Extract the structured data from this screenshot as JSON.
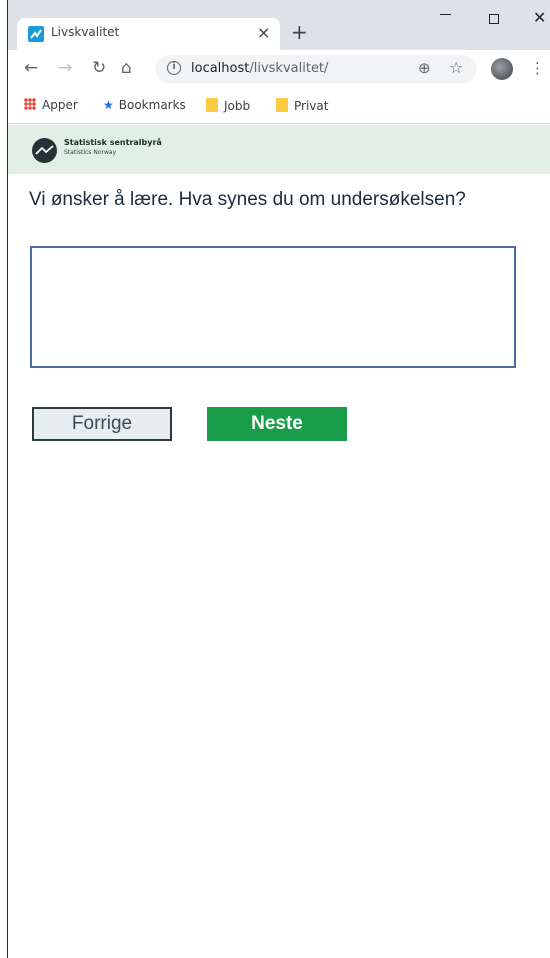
{
  "browser": {
    "tab_title": "Livskvalitet",
    "tab_close": "×",
    "new_tab": "+",
    "url_host": "localhost",
    "url_path": "/livskvalitet/",
    "icons": [
      "back-icon",
      "forward-icon",
      "reload-icon",
      "home-icon",
      "info-icon",
      "zoom-icon",
      "star-icon",
      "avatar",
      "menu-icon"
    ]
  },
  "bookmarks": {
    "apps": "Apper",
    "bookmarks": "Bookmarks",
    "folder1": "Jobb",
    "folder2": "Privat"
  },
  "header": {
    "org_name": "Statistisk sentralbyrå",
    "org_sub": "Statistics Norway",
    "bg_color": "#e2efe6"
  },
  "survey": {
    "question": "Vi ønsker å lære. Hva synes du om undersøkelsen?",
    "answer_value": "",
    "prev_label": "Forrige",
    "next_label": "Neste",
    "next_color": "#1a9d49"
  }
}
